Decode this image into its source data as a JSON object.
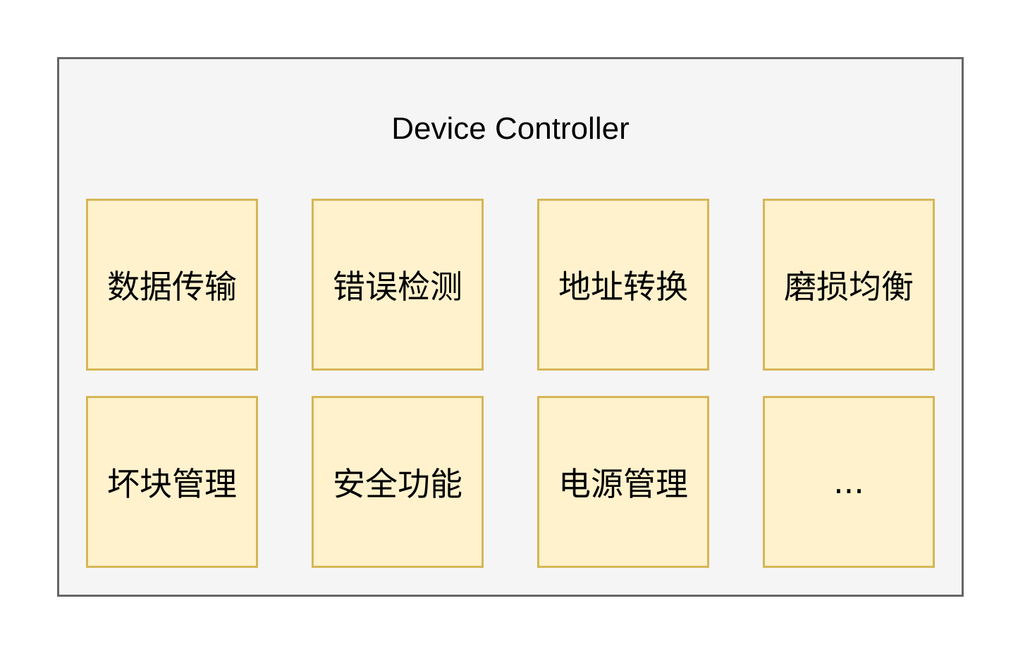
{
  "diagram": {
    "title": "Device Controller",
    "modules": [
      "数据传输",
      "错误检测",
      "地址转换",
      "磨损均衡",
      "坏块管理",
      "安全功能",
      "电源管理",
      "..."
    ]
  },
  "colors": {
    "container_fill": "#f5f5f5",
    "container_border": "#666666",
    "module_fill": "#fff2cc",
    "module_border": "#d6b656"
  }
}
